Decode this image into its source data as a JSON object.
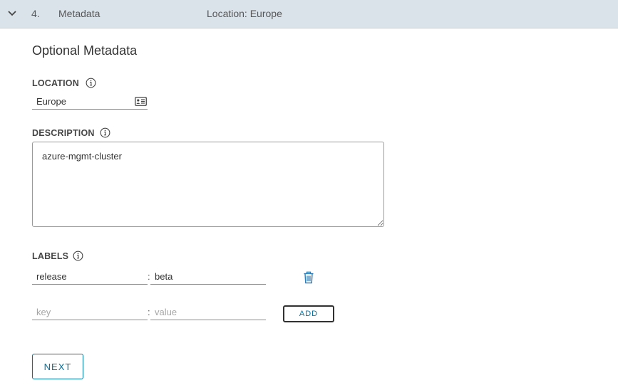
{
  "step": {
    "number": "4.",
    "title": "Metadata",
    "summary": "Location: Europe"
  },
  "section": {
    "title": "Optional Metadata"
  },
  "location": {
    "label": "LOCATION",
    "value": "Europe"
  },
  "description": {
    "label": "DESCRIPTION",
    "value": "azure-mgmt-cluster"
  },
  "labels": {
    "label": "LABELS",
    "items": [
      {
        "key": "release",
        "value": "beta"
      }
    ],
    "new": {
      "key_placeholder": "key",
      "value_placeholder": "value",
      "add_label": "ADD"
    }
  },
  "footer": {
    "next_label": "NEXT"
  },
  "icons": {
    "collapse": "chevron-down-icon",
    "info": "info-icon",
    "location_picker": "id-card-icon",
    "delete": "trash-icon"
  },
  "colors": {
    "header_bg": "#dbe3ea",
    "accent": "#0072a3"
  }
}
